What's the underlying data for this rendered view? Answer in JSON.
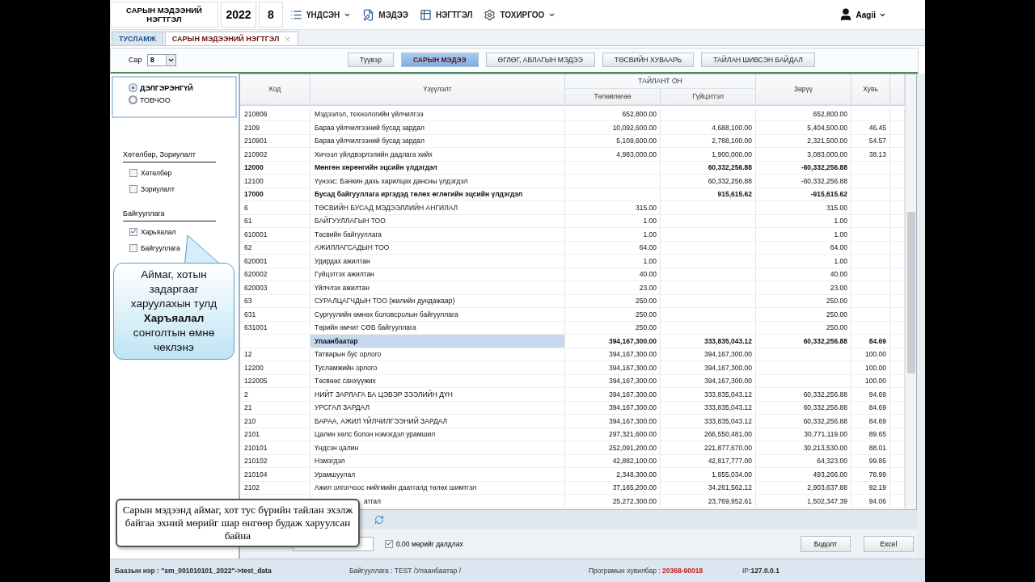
{
  "header": {
    "title": "САРЫН МЭДЭЭНИЙ НЭГТГЭЛ",
    "year": "2022",
    "month": "8",
    "menu": [
      {
        "label": "ҮНДСЭН",
        "dropdown": true
      },
      {
        "label": "МЭДЭЭ",
        "dropdown": false
      },
      {
        "label": "НЭГТГЭЛ",
        "dropdown": false
      },
      {
        "label": "ТОХИРГОО",
        "dropdown": true
      }
    ],
    "user": "Aagii"
  },
  "tabs": [
    {
      "label": "ТУСЛАМЖ",
      "selected": false,
      "closable": false
    },
    {
      "label": "САРЫН МЭДЭЭНИЙ НЭГТГЭЛ",
      "selected": true,
      "closable": true
    }
  ],
  "toolbar": {
    "month_label": "Сар",
    "month_value": "8",
    "buttons": [
      {
        "label": "Түүвэр",
        "selected": false
      },
      {
        "label": "САРЫН МЭДЭЭ",
        "selected": true
      },
      {
        "label": "ӨГЛӨГ, АВЛАГЫН МЭДЭЭ",
        "selected": false
      },
      {
        "label": "ТӨСВИЙН ХУВААРЬ",
        "selected": false
      },
      {
        "label": "ТАЙЛАН ШИВСЭН БАЙДАЛ",
        "selected": false
      }
    ]
  },
  "sidebar": {
    "view_options": [
      {
        "label": "ДЭЛГЭРЭНГҮЙ",
        "selected": true
      },
      {
        "label": "ТОВЧОО",
        "selected": false
      }
    ],
    "groups": [
      {
        "title": "Хөтөлбөр, Зориулалт",
        "items": [
          {
            "label": "Хөтөлбөр",
            "checked": false
          },
          {
            "label": "Зориулалт",
            "checked": false
          }
        ]
      },
      {
        "title": "Байгууллага",
        "items": [
          {
            "label": "Харьяалал",
            "checked": true
          },
          {
            "label": "Байгууллага",
            "checked": false
          }
        ]
      }
    ]
  },
  "table": {
    "columns": {
      "code": "Код",
      "name": "Үзүүлэлт",
      "group": "ТАЙЛАНТ ОН",
      "plan": "Төлөвлөгөө",
      "actual": "Гүйцэтгэл",
      "diff": "Зөрүү",
      "pct": "Хувь"
    },
    "rows": [
      {
        "kind": "normal",
        "code": "210806",
        "name": "Мэдээлэл, технологийн үйлчилгээ",
        "plan": "652,800.00",
        "diff": "652,800.00"
      },
      {
        "kind": "normal",
        "code": "2109",
        "name": "Бараа үйлчилгээний бусад зардал",
        "plan": "10,092,600.00",
        "actual": "4,688,100.00",
        "diff": "5,404,500.00",
        "pct": "46.45"
      },
      {
        "kind": "normal",
        "code": "210901",
        "name": "Бараа үйлчилгээний бусад зардал",
        "plan": "5,109,600.00",
        "actual": "2,788,100.00",
        "diff": "2,321,500.00",
        "pct": "54.57"
      },
      {
        "kind": "normal",
        "code": "210902",
        "name": "Хичээл үйлдвэрлэлийн дадлага хийх",
        "plan": "4,983,000.00",
        "actual": "1,900,000.00",
        "diff": "3,083,000.00",
        "pct": "38.13"
      },
      {
        "kind": "bold",
        "code": "12000",
        "name": "Мөнгөн хөрөнгийн эцсийн үлдэгдэл",
        "actual": "60,332,256.88",
        "diff": "-60,332,256.88"
      },
      {
        "kind": "normal",
        "code": "12100",
        "name": "Үүнээс: Банкин дахь харилцах дансны үлдэгдэл",
        "actual": "60,332,256.88",
        "diff": "-60,332,256.88"
      },
      {
        "kind": "bold",
        "code": "17000",
        "name": "Бусад байгууллага иргэдэд төлөх өглөгийн эцсийн үлдэгдэл",
        "actual": "915,615.62",
        "diff": "-915,615.62"
      },
      {
        "kind": "normal",
        "code": "6",
        "name": "ТӨСВИЙН БУСАД МЭДЭЭЛЛИЙН АНГИЛАЛ",
        "plan": "315.00",
        "diff": "315.00"
      },
      {
        "kind": "normal",
        "code": "61",
        "name": "БАЙГУУЛЛАГЫН ТОО",
        "plan": "1.00",
        "diff": "1.00"
      },
      {
        "kind": "normal",
        "code": "610001",
        "name": "Төсвийн байгууллага",
        "plan": "1.00",
        "diff": "1.00"
      },
      {
        "kind": "normal",
        "code": "62",
        "name": "АЖИЛЛАГСАДЫН ТОО",
        "plan": "64.00",
        "diff": "64.00"
      },
      {
        "kind": "normal",
        "code": "620001",
        "name": "Удирдах ажилтан",
        "plan": "1.00",
        "diff": "1.00"
      },
      {
        "kind": "normal",
        "code": "620002",
        "name": "Гүйцэтгэх ажилтан",
        "plan": "40.00",
        "diff": "40.00"
      },
      {
        "kind": "normal",
        "code": "620003",
        "name": "Үйлчлэх ажилтан",
        "plan": "23.00",
        "diff": "23.00"
      },
      {
        "kind": "normal",
        "code": "63",
        "name": "СУРАЛЦАГЧДЫН ТОО (жилийн дундажаар)",
        "plan": "250.00",
        "diff": "250.00"
      },
      {
        "kind": "normal",
        "code": "631",
        "name": "Сургуулийн өмнөх боловсролын байгууллага",
        "plan": "250.00",
        "diff": "250.00"
      },
      {
        "kind": "normal",
        "code": "631001",
        "name": "Төрийн өмчит СӨБ байгууллага",
        "plan": "250.00",
        "diff": "250.00"
      },
      {
        "kind": "region",
        "name": "Улаанбаатар",
        "plan": "394,167,300.00",
        "actual": "333,835,043.12",
        "diff": "60,332,256.88",
        "pct": "84.69"
      },
      {
        "kind": "normal",
        "code": "12",
        "name": "Татварын бус орлого",
        "plan": "394,167,300.00",
        "actual": "394,167,300.00",
        "pct": "100.00"
      },
      {
        "kind": "normal",
        "code": "12200",
        "name": "Тусламжийн орлого",
        "plan": "394,167,300.00",
        "actual": "394,167,300.00",
        "pct": "100.00"
      },
      {
        "kind": "normal",
        "code": "122005",
        "name": "Төсвөөс санхүүжих",
        "plan": "394,167,300.00",
        "actual": "394,167,300.00",
        "pct": "100.00"
      },
      {
        "kind": "normal",
        "code": "2",
        "name": "НИЙТ ЗАРЛАГА БА ЦЭВЭР ЗЭЭЛИЙН ДҮН",
        "plan": "394,167,300.00",
        "actual": "333,835,043.12",
        "diff": "60,332,256.88",
        "pct": "84.69"
      },
      {
        "kind": "normal",
        "code": "21",
        "name": "УРСГАЛ ЗАРДАЛ",
        "plan": "394,167,300.00",
        "actual": "333,835,043.12",
        "diff": "60,332,256.88",
        "pct": "84.69"
      },
      {
        "kind": "normal",
        "code": "210",
        "name": "БАРАА, АЖИЛ ҮЙЛЧИЛГЭЭНИЙ ЗАРДАЛ",
        "plan": "394,167,300.00",
        "actual": "333,835,043.12",
        "diff": "60,332,256.88",
        "pct": "84.69"
      },
      {
        "kind": "normal",
        "code": "2101",
        "name": "Цалин хөлс болон нэмэгдэл урамшил",
        "plan": "297,321,600.00",
        "actual": "266,550,481.00",
        "diff": "30,771,119.00",
        "pct": "89.65"
      },
      {
        "kind": "normal",
        "code": "210101",
        "name": "Үндсэн цалин",
        "plan": "252,091,200.00",
        "actual": "221,877,670.00",
        "diff": "30,213,530.00",
        "pct": "88.01"
      },
      {
        "kind": "normal",
        "code": "210102",
        "name": "Нэмэгдэл",
        "plan": "42,882,100.00",
        "actual": "42,817,777.00",
        "diff": "64,323.00",
        "pct": "99.85"
      },
      {
        "kind": "normal",
        "code": "210104",
        "name": "Урамшуулал",
        "plan": "2,348,300.00",
        "actual": "1,855,034.00",
        "diff": "493,266.00",
        "pct": "78.99"
      },
      {
        "kind": "normal",
        "code": "2102",
        "name": "Ажил олгогчоос нийгмийн даатгалд төлөх шимтгэл",
        "plan": "37,165,200.00",
        "actual": "34,261,562.12",
        "diff": "2,903,637.88",
        "pct": "92.19"
      },
      {
        "kind": "covered",
        "name": "атгал",
        "plan": "25,272,300.00",
        "actual": "23,769,952.61",
        "diff": "1,502,347.39",
        "pct": "94.06"
      }
    ]
  },
  "footer": {
    "hide_zero": {
      "label": "0.00 мөрийг далдлах",
      "checked": true
    },
    "buttons": [
      "Бодолт",
      "Excel"
    ]
  },
  "callouts": [
    {
      "kind": "bubble",
      "text": "Аймаг, хотын задаргааг харуулахын тулд **Харъяалал** сонголтын өмнө чеклэнэ"
    },
    {
      "kind": "box",
      "text": "Сарын мэдээнд аймаг, хот тус бүрийн тайлан эхэлж байгаа эхний мөрийг шар өнгөөр будаж харуулсан байна"
    }
  ],
  "status_bar": [
    {
      "label": "Баазын нэр : ",
      "value": "\"sm_001010101_2022\"->test_data",
      "kind": "bold"
    },
    {
      "label": "Байгууллага : TEST /Улаанбаатар /",
      "kind": "plain"
    },
    {
      "label": "Програмын хувилбар : ",
      "value": "20368-90018",
      "kind": "red"
    },
    {
      "label": "IP:",
      "value": "127.0.0.1",
      "kind": "bold"
    }
  ]
}
